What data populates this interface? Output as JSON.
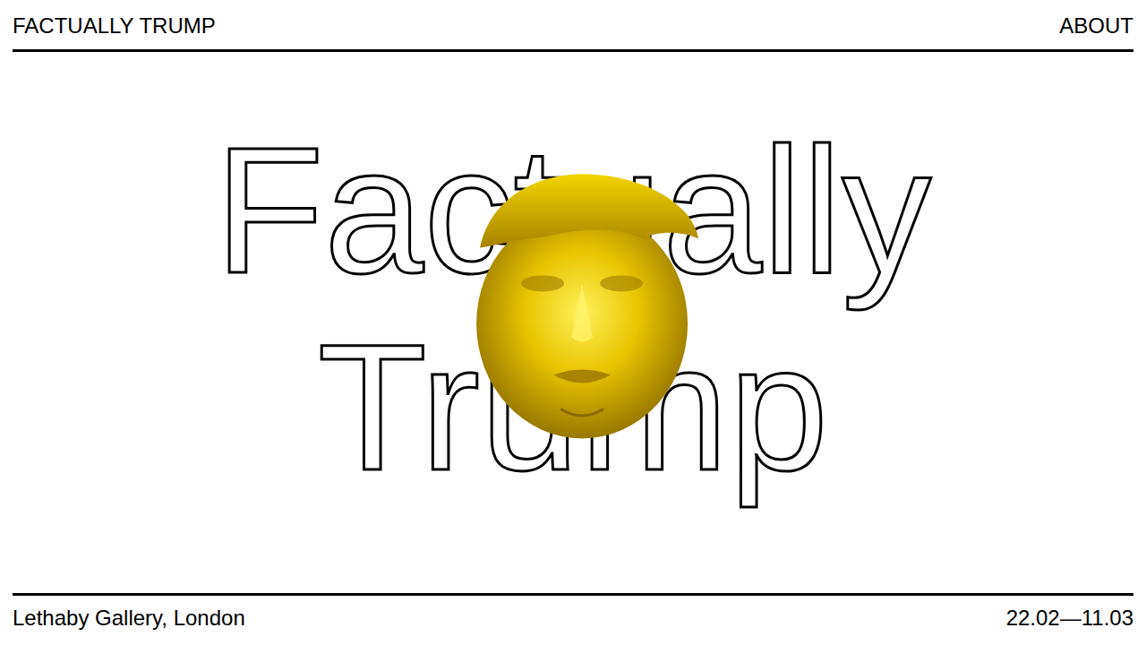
{
  "header": {
    "title": "FACTUALLY TRUMP",
    "nav": [
      "ABOUT"
    ]
  },
  "hero": {
    "title_lines": [
      "Factually",
      "Trump"
    ]
  },
  "footer": {
    "venue": "Lethaby Gallery, London",
    "dates": "22.02—11.03"
  }
}
